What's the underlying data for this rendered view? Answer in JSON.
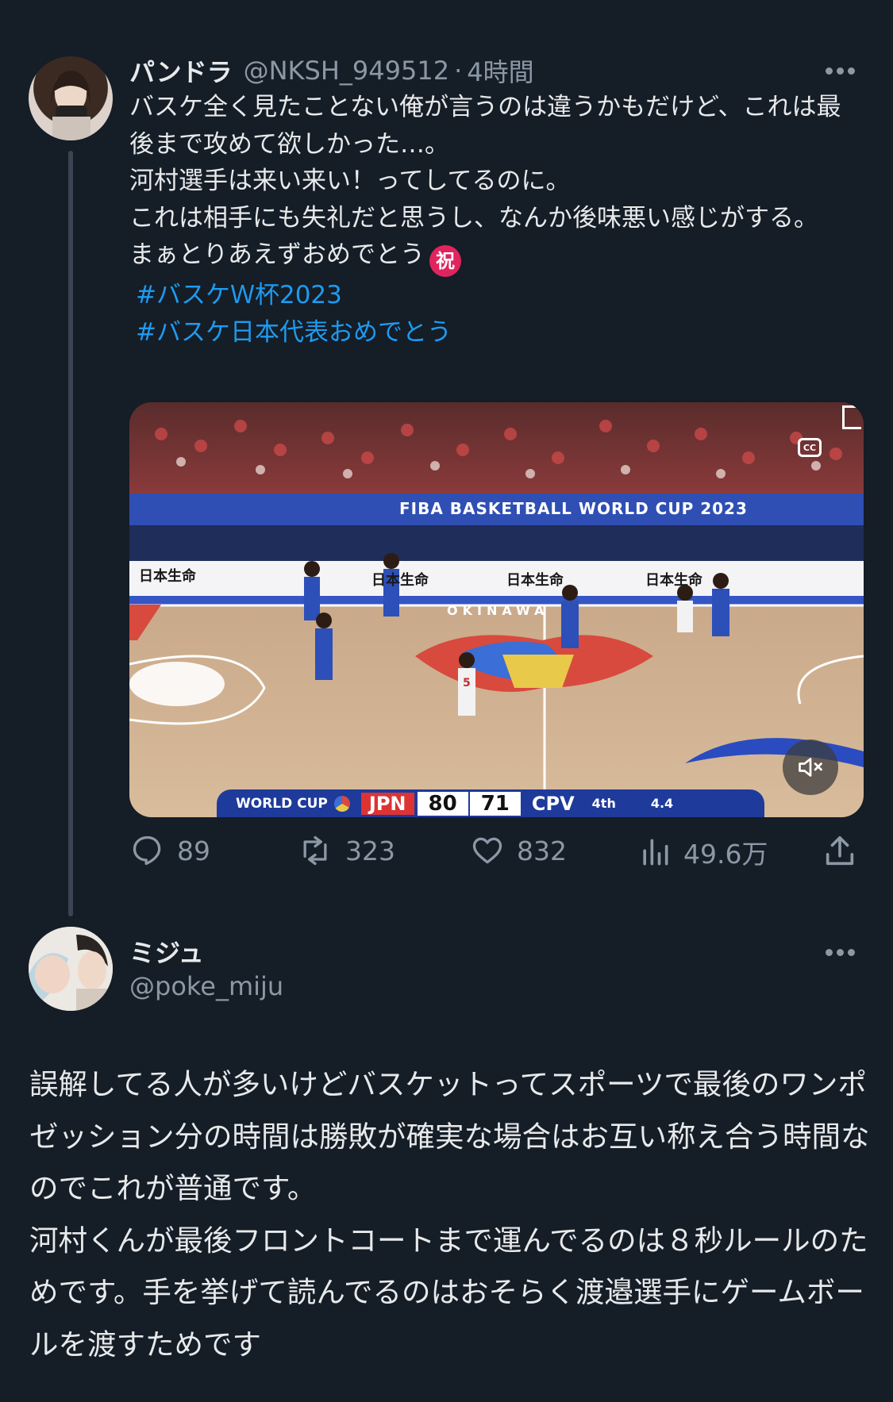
{
  "tweet1": {
    "display_name": "パンドラ",
    "handle": "@NKSH_949512",
    "separator": "·",
    "time": "4時間",
    "text": "バスケ全く見たことない俺が言うのは違うかもだけど、これは最後まで攻めて欲しかった…。\n河村選手は来い来い！ってしてるのに。\nこれは相手にも失礼だと思うし、なんか後味悪い感じがする。\nまぁとりあえずおめでとう",
    "emoji": "祝",
    "hashtags": [
      "#バスケＷ杯2023",
      "#バスケ日本代表おめでとう"
    ],
    "video": {
      "banner": "FIBA BASKETBALL WORLD CUP 2023",
      "sponsor": "日本生命",
      "court_text": "OKINAWA",
      "jersey_number": "5",
      "scoreboard": {
        "event": "WORLD CUP",
        "team1": "JPN",
        "score1": "80",
        "score2": "71",
        "team2": "CPV",
        "period": "4th",
        "clock": "4.4"
      }
    },
    "stats": {
      "replies": "89",
      "retweets": "323",
      "likes": "832",
      "views": "49.6万"
    }
  },
  "tweet2": {
    "display_name": "ミジュ",
    "handle": "@poke_miju",
    "text": "誤解してる人が多いけどバスケットってスポーツで最後のワンポゼッション分の時間は勝敗が確実な場合はお互い称え合う時間なのでこれが普通です。\n河村くんが最後フロントコートまで運んでるのは８秒ルールのためです。手を挙げて読んでるのはおそらく渡邉選手にゲームボールを渡すためです"
  },
  "colors": {
    "background": "#151d27",
    "text": "#e7e9ea",
    "muted": "#8b98a5",
    "link": "#1d9bf0"
  }
}
